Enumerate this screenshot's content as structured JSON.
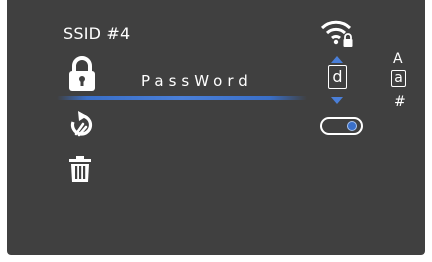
{
  "network": {
    "ssid_label": "SSID #4",
    "password_value": "PassWord"
  },
  "editor": {
    "current_char": "d",
    "toggle_on": true
  },
  "charset": {
    "upper": "A",
    "lower": "a",
    "symbol": "#"
  },
  "icons": {
    "lock": "lock-icon",
    "refresh": "refresh-icon",
    "delete": "trash-icon",
    "wifi": "wifi-lock-icon"
  },
  "colors": {
    "background": "#404040",
    "accent": "#3a6fc8",
    "text": "#ffffff"
  }
}
